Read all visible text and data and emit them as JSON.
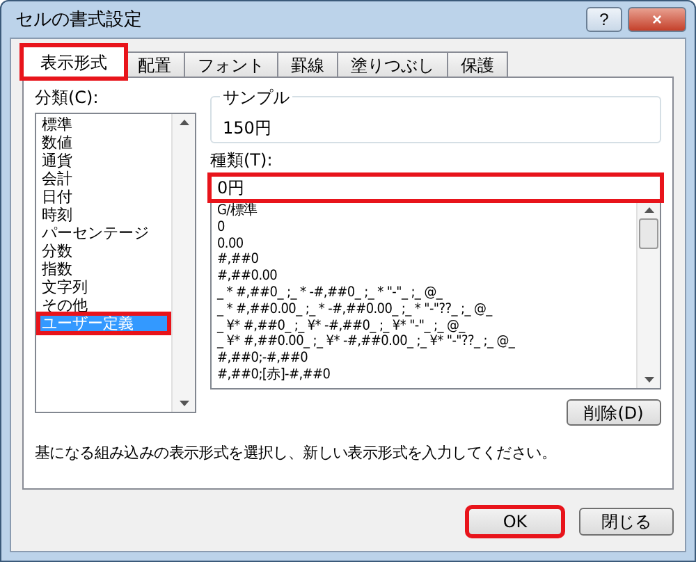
{
  "window": {
    "title": "セルの書式設定",
    "help_button": "?",
    "close_button": "×"
  },
  "tabs": [
    {
      "label": "表示形式",
      "selected": true,
      "highlighted": true
    },
    {
      "label": "配置",
      "selected": false,
      "highlighted": false
    },
    {
      "label": "フォント",
      "selected": false,
      "highlighted": false
    },
    {
      "label": "罫線",
      "selected": false,
      "highlighted": false
    },
    {
      "label": "塗りつぶし",
      "selected": false,
      "highlighted": false
    },
    {
      "label": "保護",
      "selected": false,
      "highlighted": false
    }
  ],
  "category": {
    "label": "分類(C):",
    "items": [
      {
        "label": "標準",
        "selected": false,
        "highlighted": false
      },
      {
        "label": "数値",
        "selected": false,
        "highlighted": false
      },
      {
        "label": "通貨",
        "selected": false,
        "highlighted": false
      },
      {
        "label": "会計",
        "selected": false,
        "highlighted": false
      },
      {
        "label": "日付",
        "selected": false,
        "highlighted": false
      },
      {
        "label": "時刻",
        "selected": false,
        "highlighted": false
      },
      {
        "label": "パーセンテージ",
        "selected": false,
        "highlighted": false
      },
      {
        "label": "分数",
        "selected": false,
        "highlighted": false
      },
      {
        "label": "指数",
        "selected": false,
        "highlighted": false
      },
      {
        "label": "文字列",
        "selected": false,
        "highlighted": false
      },
      {
        "label": "その他",
        "selected": false,
        "highlighted": false
      },
      {
        "label": "ユーザー定義",
        "selected": true,
        "highlighted": true
      }
    ]
  },
  "sample": {
    "label": "サンプル",
    "value": "150円"
  },
  "type": {
    "label": "種類(T):",
    "value": "0円",
    "highlighted": true,
    "formats": [
      "G/標準",
      "0",
      "0.00",
      "#,##0",
      "#,##0.00",
      "_ * #,##0_ ;_ * -#,##0_ ;_ * \"-\"_ ;_ @_",
      "_ * #,##0.00_ ;_ * -#,##0.00_ ;_ * \"-\"??_ ;_ @_",
      "_ ¥* #,##0_ ;_ ¥* -#,##0_ ;_ ¥* \"-\"_ ;_ @_",
      "_ ¥* #,##0.00_ ;_ ¥* -#,##0.00_ ;_ ¥* \"-\"??_ ;_ @_",
      "#,##0;-#,##0",
      "#,##0;[赤]-#,##0"
    ]
  },
  "delete_button": "削除(D)",
  "description": "基になる組み込みの表示形式を選択し、新しい表示形式を入力してください。",
  "buttons": [
    {
      "label": "OK",
      "highlighted": true
    },
    {
      "label": "閉じる",
      "highlighted": false
    }
  ]
}
